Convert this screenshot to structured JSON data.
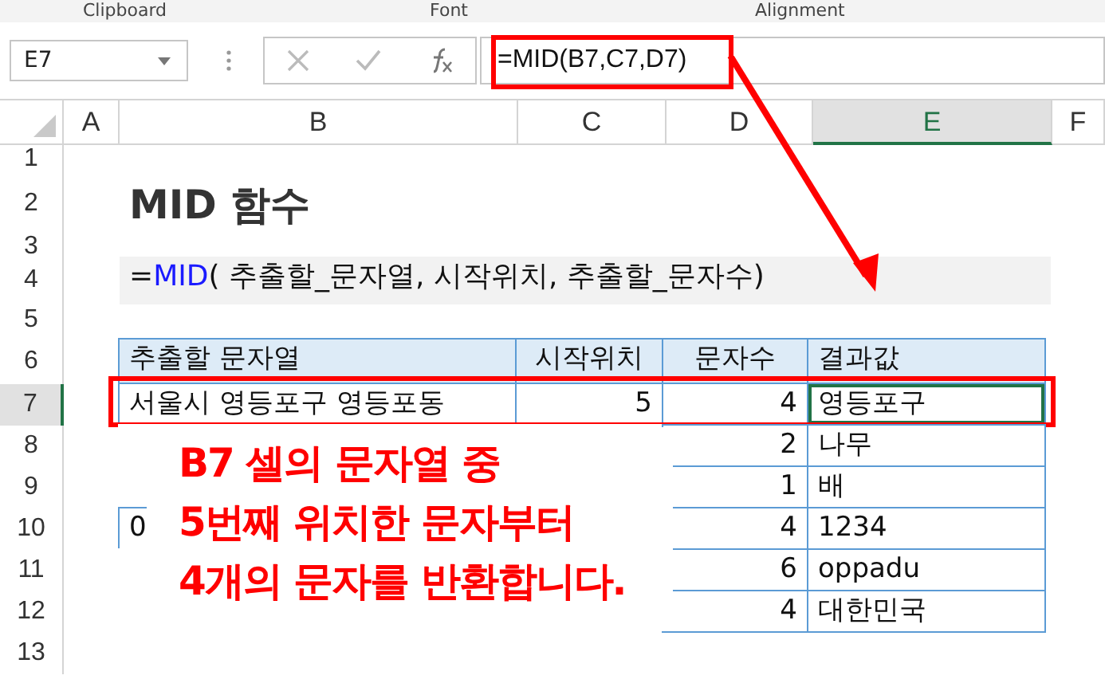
{
  "ribbon_groups": [
    "Clipboard",
    "Font",
    "Alignment"
  ],
  "name_box": "E7",
  "formula": "=MID(B7,C7,D7)",
  "columns": [
    {
      "label": "A",
      "selected": false
    },
    {
      "label": "B",
      "selected": false
    },
    {
      "label": "C",
      "selected": false
    },
    {
      "label": "D",
      "selected": false
    },
    {
      "label": "E",
      "selected": true
    },
    {
      "label": "F",
      "selected": false
    }
  ],
  "rows": [
    {
      "label": "1",
      "selected": false
    },
    {
      "label": "2",
      "selected": false
    },
    {
      "label": "3",
      "selected": false
    },
    {
      "label": "4",
      "selected": false
    },
    {
      "label": "5",
      "selected": false
    },
    {
      "label": "6",
      "selected": false
    },
    {
      "label": "7",
      "selected": true
    },
    {
      "label": "8",
      "selected": false
    },
    {
      "label": "9",
      "selected": false
    },
    {
      "label": "10",
      "selected": false
    },
    {
      "label": "11",
      "selected": false
    },
    {
      "label": "12",
      "selected": false
    },
    {
      "label": "13",
      "selected": false
    }
  ],
  "title": "MID 함수",
  "syntax": {
    "prefix": "=",
    "function": "MID",
    "args": "( 추출할_문자열, 시작위치, 추출할_문자수)"
  },
  "table": {
    "columns": [
      "추출할 문자열",
      "시작위치",
      "문자수",
      "결과값"
    ],
    "rows": [
      {
        "text": "서울시 영등포구 영등포동",
        "start": "5",
        "count": "4",
        "result": "영등포구",
        "highlighted": true
      },
      {
        "count": "2",
        "result": "나무",
        "highlighted": false
      },
      {
        "count": "1",
        "result": "배",
        "highlighted": false
      },
      {
        "text": "0",
        "count": "4",
        "result": "1234",
        "highlighted": false
      },
      {
        "count": "6",
        "result": "oppadu",
        "highlighted": false
      },
      {
        "count": "4",
        "result": "대한민국",
        "highlighted": false
      }
    ]
  },
  "callout": [
    "B7 셀의 문자열 중",
    "5번째 위치한 문자부터",
    "4개의 문자를 반환합니다."
  ]
}
